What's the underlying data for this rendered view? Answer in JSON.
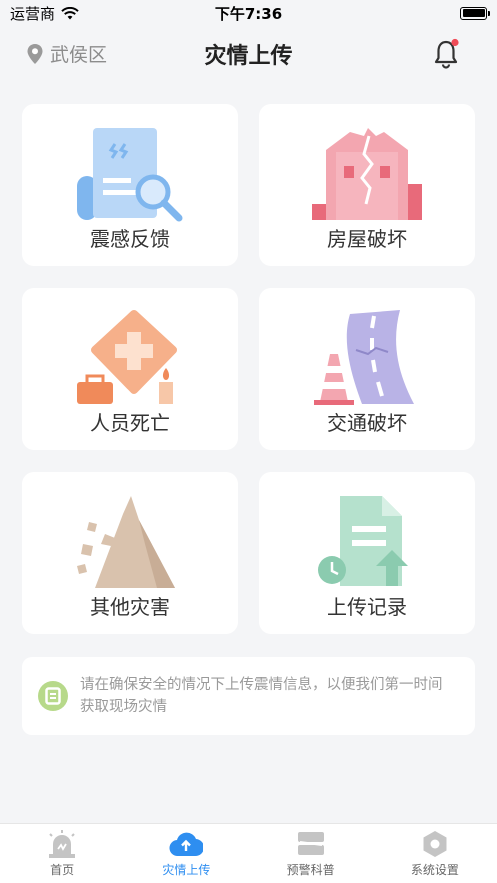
{
  "status": {
    "carrier": "运营商",
    "time": "下午7:36"
  },
  "nav": {
    "location": "武侯区",
    "title": "灾情上传"
  },
  "cards": [
    {
      "label": "震感反馈",
      "icon": "document-search-icon"
    },
    {
      "label": "房屋破坏",
      "icon": "cracked-building-icon"
    },
    {
      "label": "人员死亡",
      "icon": "first-aid-icon"
    },
    {
      "label": "交通破坏",
      "icon": "damaged-road-icon"
    },
    {
      "label": "其他灾害",
      "icon": "landslide-icon"
    },
    {
      "label": "上传记录",
      "icon": "upload-record-icon"
    }
  ],
  "notice": {
    "text": "请在确保安全的情况下上传震情信息，以便我们第一时间获取现场灾情"
  },
  "tabs": [
    {
      "label": "首页",
      "icon": "alarm-icon"
    },
    {
      "label": "灾情上传",
      "icon": "cloud-upload-icon"
    },
    {
      "label": "预警科普",
      "icon": "book-icon"
    },
    {
      "label": "系统设置",
      "icon": "settings-hexagon-icon"
    }
  ],
  "colors": {
    "accent": "#2e8ef0",
    "bell_dot": "#f04b57"
  }
}
